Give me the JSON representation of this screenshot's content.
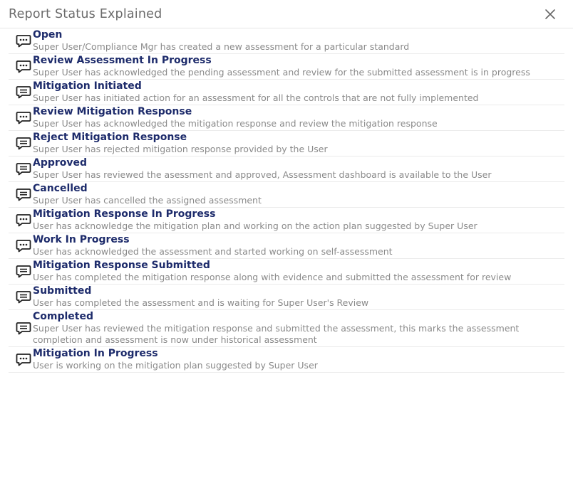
{
  "modal": {
    "title": "Report Status Explained",
    "close_icon": "close-icon"
  },
  "statuses": [
    {
      "name": "Open",
      "desc": "Super User/Compliance Mgr has created a new assessment for a particular standard",
      "icon": "chat-dots"
    },
    {
      "name": "Review Assessment In Progress",
      "desc": "Super User has acknowledged the pending assessment and review for the submitted assessment is in progress",
      "icon": "chat-dots"
    },
    {
      "name": "Mitigation Initiated",
      "desc": "Super User has initiated action for an assessment for all the controls that are not fully implemented",
      "icon": "chat-lines"
    },
    {
      "name": "Review Mitigation Response",
      "desc": "Super User has acknowledged the mitigation response and review the mitigation response",
      "icon": "chat-dots"
    },
    {
      "name": "Reject Mitigation Response",
      "desc": "Super User has rejected mitigation response provided by the User",
      "icon": "chat-lines"
    },
    {
      "name": "Approved",
      "desc": "Super User has reviewed the asessment and approved, Assessment dashboard is available to the User",
      "icon": "chat-lines"
    },
    {
      "name": "Cancelled",
      "desc": "Super User has cancelled the assigned assessment",
      "icon": "chat-lines"
    },
    {
      "name": "Mitigation Response In Progress",
      "desc": "User has acknowledge the mitigation plan and working on the action plan suggested by Super User",
      "icon": "chat-dots"
    },
    {
      "name": "Work In Progress",
      "desc": "User has acknowledged the assessment and started working on self-assessment",
      "icon": "chat-dots"
    },
    {
      "name": "Mitigation Response Submitted",
      "desc": "User has completed the mitigation response along with evidence and submitted the assessment for review",
      "icon": "chat-lines"
    },
    {
      "name": "Submitted",
      "desc": "User has completed the assessment and is waiting for Super User's Review",
      "icon": "chat-lines"
    },
    {
      "name": "Completed",
      "desc": "Super User has reviewed the mitigation response and submitted the assessment, this marks the assessment completion and assessment is now under historical assessment",
      "icon": "chat-lines"
    },
    {
      "name": "Mitigation In Progress",
      "desc": "User is working on the mitigation plan suggested by Super User",
      "icon": "chat-dots"
    }
  ]
}
